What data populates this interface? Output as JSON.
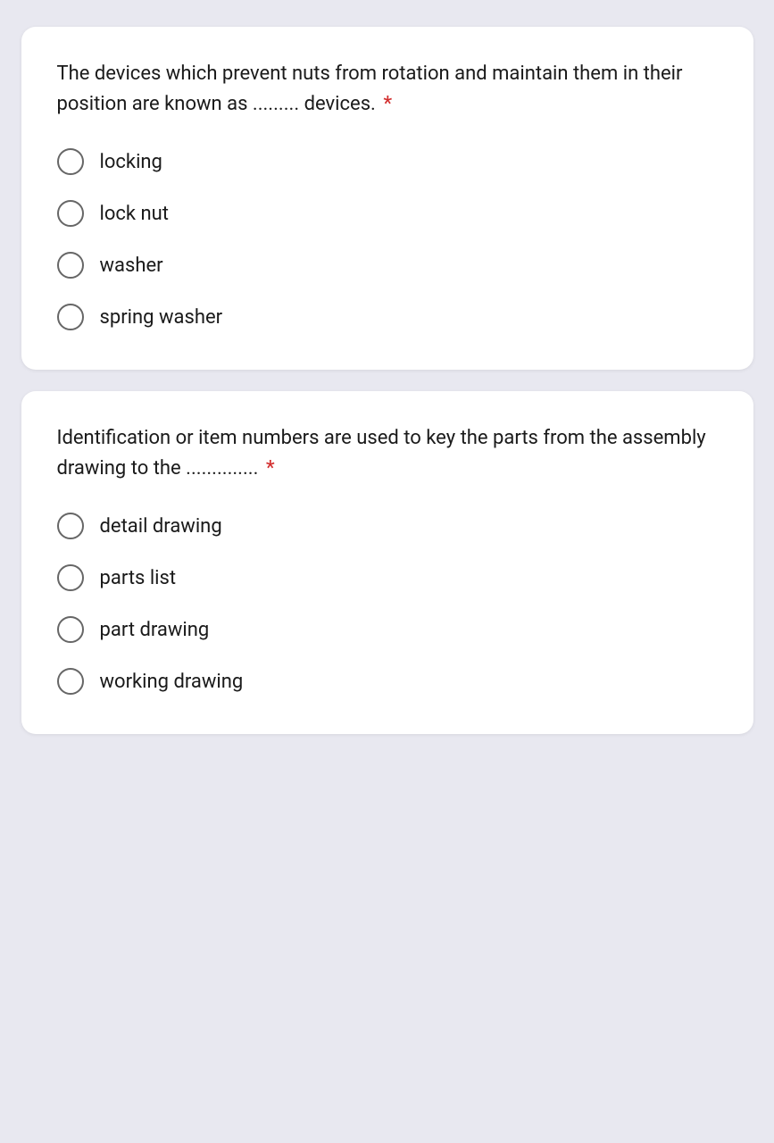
{
  "question1": {
    "text": "The devices which prevent nuts from rotation and maintain them in their position are known as ......... devices.",
    "required": "*",
    "options": [
      {
        "id": "q1_locking",
        "label": "locking"
      },
      {
        "id": "q1_lock_nut",
        "label": "lock nut"
      },
      {
        "id": "q1_washer",
        "label": "washer"
      },
      {
        "id": "q1_spring_washer",
        "label": "spring washer"
      }
    ]
  },
  "question2": {
    "text": "Identification or item numbers are used to key the parts from the assembly drawing to the ..............",
    "required": "*",
    "options": [
      {
        "id": "q2_detail_drawing",
        "label": "detail drawing"
      },
      {
        "id": "q2_parts_list",
        "label": "parts list"
      },
      {
        "id": "q2_part_drawing",
        "label": "part drawing"
      },
      {
        "id": "q2_working_drawing",
        "label": "working drawing"
      }
    ]
  }
}
